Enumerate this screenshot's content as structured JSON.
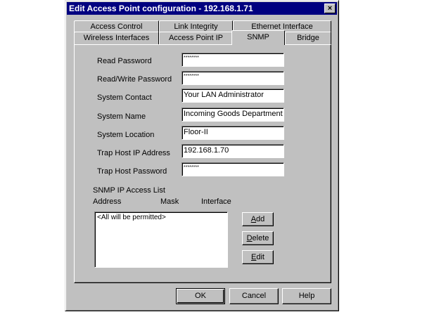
{
  "window": {
    "title": "Edit Access Point configuration - 192.168.1.71",
    "close_glyph": "×"
  },
  "tabs": {
    "access_control": "Access Control",
    "link_integrity": "Link Integrity",
    "ethernet_interface": "Ethernet Interface",
    "wireless_interfaces": "Wireless Interfaces",
    "access_point_ip": "Access Point IP",
    "snmp": "SNMP",
    "bridge": "Bridge",
    "active": "SNMP"
  },
  "form": {
    "read_password": {
      "label": "Read Password",
      "value": "********"
    },
    "read_write_password": {
      "label": "Read/Write Password",
      "value": "********"
    },
    "system_contact": {
      "label": "System Contact",
      "value": "Your LAN Administrator"
    },
    "system_name": {
      "label": "System Name",
      "value": "Incoming Goods Department"
    },
    "system_location": {
      "label": "System Location",
      "value": "Floor-II"
    },
    "trap_host_ip": {
      "label": "Trap Host IP Address",
      "value": "192.168.1.70"
    },
    "trap_host_password": {
      "label": "Trap Host Password",
      "value": "********"
    }
  },
  "access_list": {
    "title": "SNMP IP Access List",
    "columns": [
      "Address",
      "Mask",
      "Interface"
    ],
    "items": [
      "<All will be permitted>"
    ],
    "add": {
      "mnemonic": "A",
      "rest": "dd"
    },
    "delete": {
      "mnemonic": "D",
      "rest": "elete"
    },
    "edit": {
      "mnemonic": "E",
      "rest": "dit"
    }
  },
  "footer": {
    "ok": "OK",
    "cancel": "Cancel",
    "help": "Help"
  },
  "colors": {
    "title_bar": "#000080",
    "face": "#c0c0c0",
    "field": "#ffffff"
  }
}
